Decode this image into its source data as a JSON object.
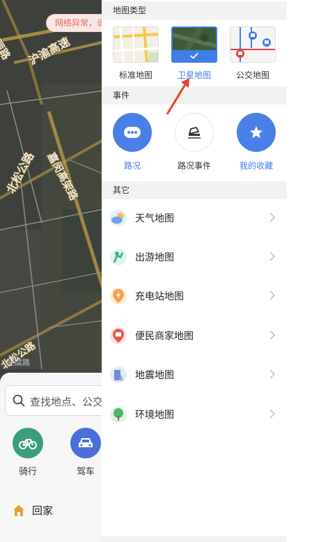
{
  "map": {
    "labels": [
      "东丽路",
      "沪渝高速",
      "北松公路",
      "嘉闵高架路",
      "北松公路",
      "豆腐路"
    ],
    "network_toast": "网络异常，请"
  },
  "bottom_sheet": {
    "search_placeholder": "查找地点、公交",
    "quick": [
      {
        "label": "骑行",
        "icon": "bike-icon",
        "color": "#3a9e7c"
      },
      {
        "label": "驾车",
        "icon": "car-icon",
        "color": "#4a6fd6"
      }
    ],
    "home_label": "回家"
  },
  "drawer": {
    "map_type_header": "地图类型",
    "map_types": [
      {
        "label": "标准地图",
        "selected": false
      },
      {
        "label": "卫星地图",
        "selected": true
      },
      {
        "label": "公交地图",
        "selected": false
      }
    ],
    "events_header": "事件",
    "events": [
      {
        "label": "路况",
        "icon": "more-dots-icon",
        "active": true
      },
      {
        "label": "路况事件",
        "icon": "traffic-event-icon",
        "active": false
      },
      {
        "label": "我的收藏",
        "icon": "star-icon",
        "active": true
      }
    ],
    "other_header": "其它",
    "others": [
      {
        "label": "天气地图",
        "icon": "weather-icon",
        "color": "#6aa3ec"
      },
      {
        "label": "出游地图",
        "icon": "travel-icon",
        "color": "#43b38a"
      },
      {
        "label": "充电站地图",
        "icon": "charging-icon",
        "color": "#f0a04b"
      },
      {
        "label": "便民商家地图",
        "icon": "shop-icon",
        "color": "#e8554a"
      },
      {
        "label": "地震地图",
        "icon": "earthquake-icon",
        "color": "#6b8fd6"
      },
      {
        "label": "环境地图",
        "icon": "environment-icon",
        "color": "#4fb36b"
      }
    ]
  },
  "colors": {
    "accent": "#3f7ee8",
    "header_bg": "#f2f2f2"
  }
}
